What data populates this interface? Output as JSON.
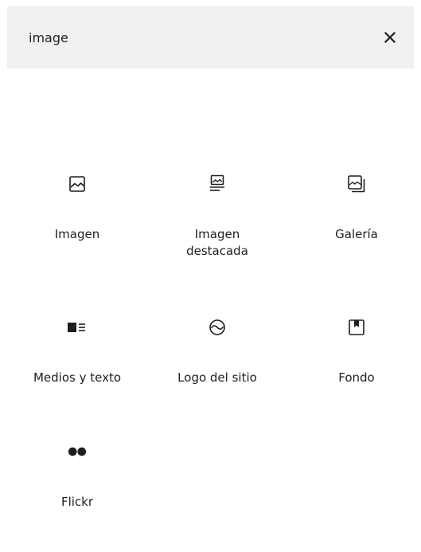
{
  "search": {
    "value": "image",
    "clear_label": "×"
  },
  "blocks": [
    {
      "label": "Imagen",
      "icon": "image-icon"
    },
    {
      "label": "Imagen\ndestacada",
      "icon": "featured-image-icon"
    },
    {
      "label": "Galería",
      "icon": "gallery-icon"
    },
    {
      "label": "Medios y texto",
      "icon": "media-text-icon"
    },
    {
      "label": "Logo del sitio",
      "icon": "site-logo-icon"
    },
    {
      "label": "Fondo",
      "icon": "cover-icon"
    },
    {
      "label": "Flickr",
      "icon": "flickr-icon"
    }
  ],
  "colors": {
    "search_background": "#f0f0f0",
    "text": "#1e1e1e"
  }
}
